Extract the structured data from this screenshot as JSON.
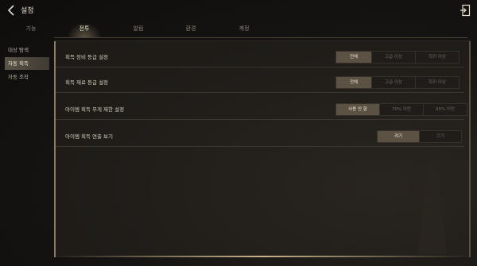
{
  "header": {
    "title": "설정"
  },
  "tabs": [
    {
      "label": "기능"
    },
    {
      "label": "전투"
    },
    {
      "label": "알림"
    },
    {
      "label": "환경"
    },
    {
      "label": "계정"
    }
  ],
  "sidebar": {
    "items": [
      {
        "label": "대상 탐색"
      },
      {
        "label": "자동 획득"
      },
      {
        "label": "자동 조작"
      }
    ]
  },
  "settings": [
    {
      "label": "획득 장비 등급 설정",
      "options": [
        "전체",
        "고급 이상",
        "희귀 이상"
      ],
      "selected": "전체"
    },
    {
      "label": "획득 재료 등급 설정",
      "options": [
        "전체",
        "고급 이상",
        "희귀 이상"
      ],
      "selected": "전체"
    },
    {
      "label": "아이템 획득 무게 제한 설정",
      "options": [
        "사용 안 함",
        "70% 미만",
        "95% 미만"
      ],
      "selected": "사용 안 함"
    },
    {
      "label": "아이템 획득 연출 보기",
      "options": [
        "켜기",
        "끄기"
      ],
      "selected": "켜기"
    }
  ]
}
